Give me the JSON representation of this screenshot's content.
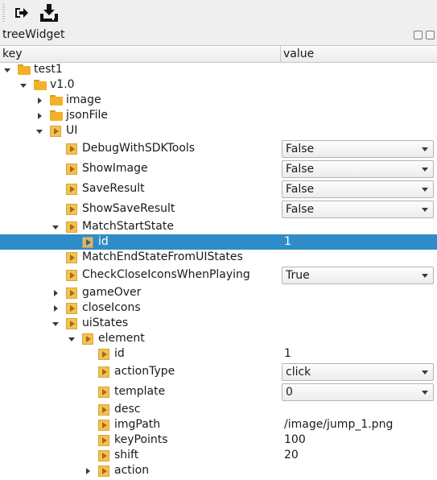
{
  "toolbar": {
    "buttons": [
      {
        "icon": "exit-icon"
      },
      {
        "icon": "download-icon"
      }
    ]
  },
  "dock": {
    "title": "treeWidget",
    "buttons": [
      "float-icon",
      "close-icon"
    ]
  },
  "header": {
    "columns": [
      "key",
      "value"
    ]
  },
  "tree": {
    "rows": [
      {
        "key": "test1",
        "value": "",
        "expander": "down",
        "icon": "folder"
      },
      {
        "key": "v1.0",
        "value": "",
        "expander": "down",
        "icon": "folder"
      },
      {
        "key": "image",
        "value": "",
        "expander": "right",
        "icon": "folder"
      },
      {
        "key": "jsonFile",
        "value": "",
        "expander": "right",
        "icon": "folder"
      },
      {
        "key": "UI",
        "value": "",
        "expander": "down",
        "icon": "field"
      },
      {
        "key": "DebugWithSDKTools",
        "value": "False",
        "editor": "combo",
        "icon": "field"
      },
      {
        "key": "ShowImage",
        "value": "False",
        "editor": "combo",
        "icon": "field"
      },
      {
        "key": "SaveResult",
        "value": "False",
        "editor": "combo",
        "icon": "field"
      },
      {
        "key": "ShowSaveResult",
        "value": "False",
        "editor": "combo",
        "icon": "field"
      },
      {
        "key": "MatchStartState",
        "value": "",
        "expander": "down",
        "icon": "field"
      },
      {
        "key": "id",
        "value": "1",
        "selected": true,
        "icon": "field"
      },
      {
        "key": "MatchEndStateFromUIStates",
        "value": "",
        "icon": "field"
      },
      {
        "key": "CheckCloseIconsWhenPlaying",
        "value": "True",
        "editor": "combo",
        "icon": "field"
      },
      {
        "key": "gameOver",
        "value": "",
        "expander": "right",
        "icon": "field"
      },
      {
        "key": "closeIcons",
        "value": "",
        "expander": "right",
        "icon": "field"
      },
      {
        "key": "uiStates",
        "value": "",
        "expander": "down",
        "icon": "field"
      },
      {
        "key": "element",
        "value": "",
        "expander": "down",
        "icon": "field"
      },
      {
        "key": "id",
        "value": "1",
        "icon": "field"
      },
      {
        "key": "actionType",
        "value": "click",
        "editor": "combo",
        "icon": "field"
      },
      {
        "key": "template",
        "value": "0",
        "editor": "combo",
        "icon": "field"
      },
      {
        "key": "desc",
        "value": "",
        "icon": "field"
      },
      {
        "key": "imgPath",
        "value": "/image/jump_1.png",
        "icon": "field"
      },
      {
        "key": "keyPoints",
        "value": "100",
        "icon": "field"
      },
      {
        "key": "shift",
        "value": "20",
        "icon": "field"
      },
      {
        "key": "action",
        "value": "",
        "expander": "right",
        "icon": "field"
      }
    ]
  }
}
